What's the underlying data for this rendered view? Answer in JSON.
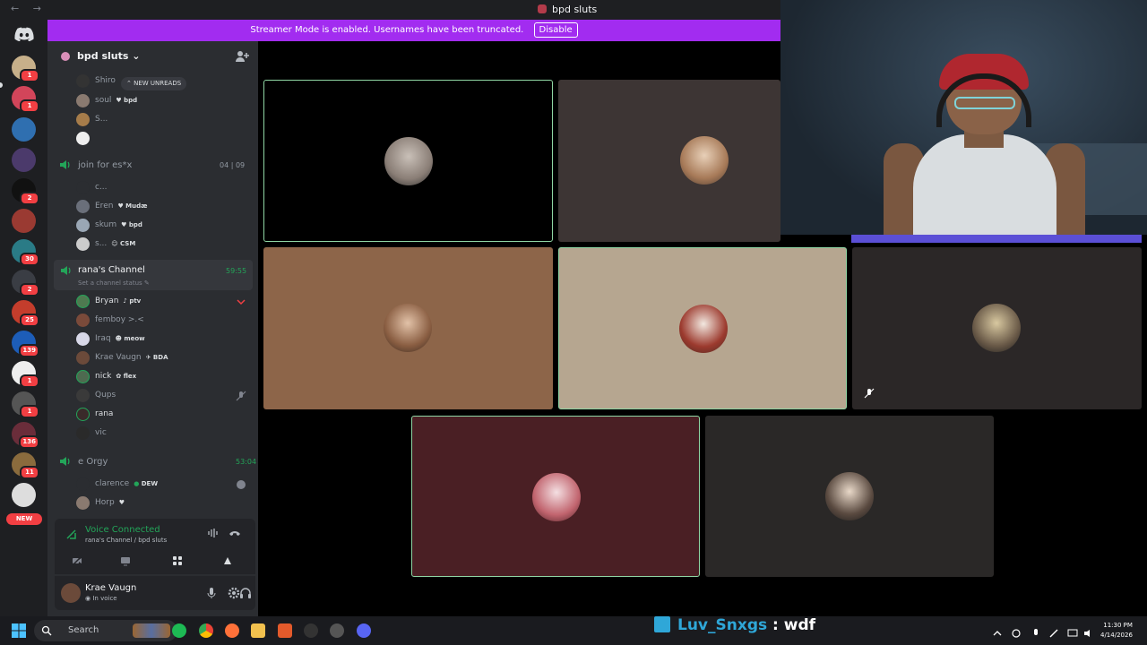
{
  "window": {
    "title": "bpd sluts",
    "nav_arrows": "← →"
  },
  "banner": {
    "message": "Streamer Mode is enabled. Usernames have been truncated.",
    "button": "Disable"
  },
  "rail": {
    "badges": [
      "1",
      "1",
      "2",
      "1",
      "30",
      "2",
      "25",
      "139",
      "1",
      "1",
      "136",
      "11"
    ],
    "new_label": "NEW"
  },
  "guild": {
    "name": "bpd sluts"
  },
  "unreads": "NEW UNREADS",
  "channels": {
    "top_users": [
      {
        "name": "Shiro",
        "tag": ""
      },
      {
        "name": "soul",
        "tag": "bpd"
      },
      {
        "name": "S...",
        "tag": ""
      },
      {
        "name": "",
        "tag": ""
      }
    ],
    "join": {
      "name": "join for es*x",
      "count_a": "04",
      "count_b": "09",
      "users": [
        {
          "name": "c...",
          "tag": ""
        },
        {
          "name": "Eren",
          "tag": "Mudæ"
        },
        {
          "name": "skum",
          "tag": "bpd"
        },
        {
          "name": "s...",
          "tag": "CSM"
        }
      ]
    },
    "active": {
      "name": "rana's Channel",
      "status": "Set a channel status",
      "timer": "59:55",
      "users": [
        {
          "name": "Bryan",
          "tag": "ptv"
        },
        {
          "name": "femboy >.<",
          "tag": ""
        },
        {
          "name": "Iraq",
          "tag": "meow"
        },
        {
          "name": "Krae Vaugn",
          "tag": "BDA"
        },
        {
          "name": "nick",
          "tag": "flex"
        },
        {
          "name": "Qups",
          "tag": ""
        },
        {
          "name": "rana",
          "tag": ""
        },
        {
          "name": "vic",
          "tag": ""
        }
      ]
    },
    "orgy": {
      "name": "e Orgy",
      "timer": "53:04",
      "users": [
        {
          "name": "clarence",
          "tag": "DEW"
        },
        {
          "name": "Horp",
          "tag": ""
        }
      ]
    }
  },
  "voice_panel": {
    "title": "Voice Connected",
    "subtitle": "rana's Channel / bpd sluts"
  },
  "user": {
    "name": "Krae Vaugn",
    "status": "In voice"
  },
  "stream_chat": {
    "user": "Luv_Snxgs",
    "message": " : wdf"
  },
  "taskbar": {
    "search": "Search",
    "time": "11:30 PM",
    "date": "4/14/2026"
  },
  "colors": {
    "accent": "#a22cf0",
    "online": "#23a559",
    "speaking": "#8fd6a4"
  }
}
